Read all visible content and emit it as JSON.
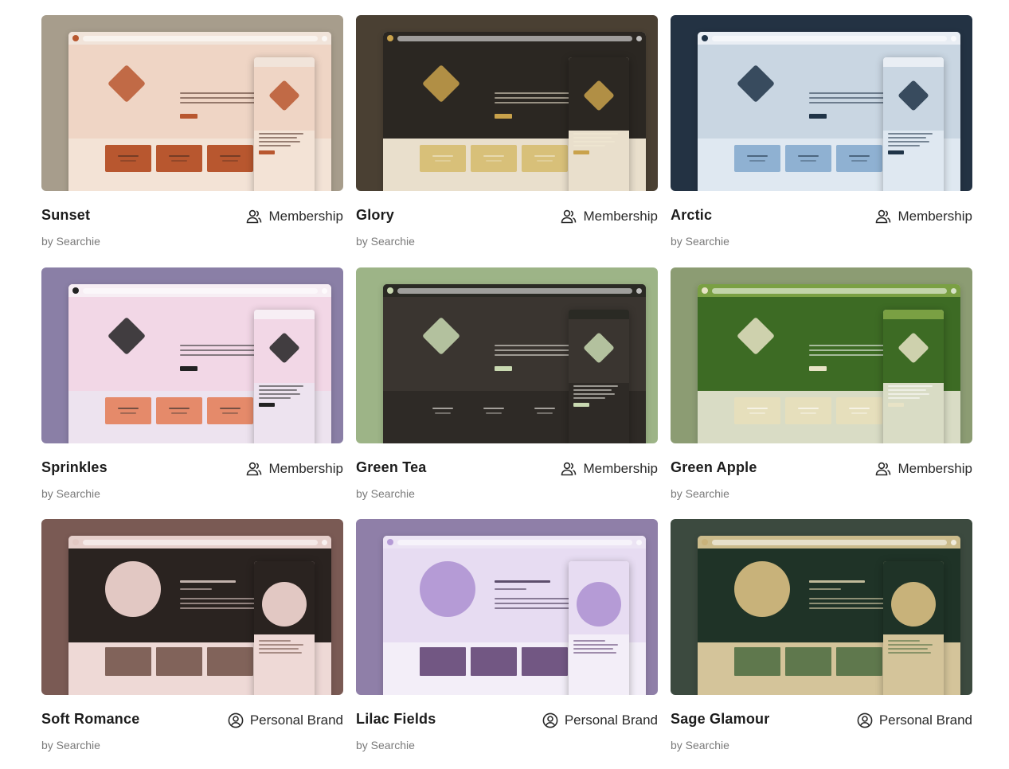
{
  "templates": [
    {
      "name": "Sunset",
      "category": "Membership",
      "author": "by Searchie",
      "icon": "users-icon",
      "colors": {
        "bg": "#a79d8c",
        "page": "#f3e3d6",
        "hero": "#efd5c5",
        "accent": "#b8572f",
        "tile": "#b8572f",
        "bar": "#f1e4da",
        "text": "#4a2c20"
      }
    },
    {
      "name": "Glory",
      "category": "Membership",
      "author": "by Searchie",
      "icon": "users-icon",
      "colors": {
        "bg": "#4a4033",
        "page": "#e9dfcc",
        "hero": "#2b2722",
        "accent": "#c9a24b",
        "tile": "#d8c079",
        "bar": "#2b2722",
        "text": "#f2e9d4"
      }
    },
    {
      "name": "Arctic",
      "category": "Membership",
      "author": "by Searchie",
      "icon": "users-icon",
      "colors": {
        "bg": "#233243",
        "page": "#dfe8f1",
        "hero": "#c9d6e2",
        "accent": "#1f3347",
        "tile": "#8fb1d2",
        "bar": "#e9eef4",
        "text": "#1f3347"
      }
    },
    {
      "name": "Sprinkles",
      "category": "Membership",
      "author": "by Searchie",
      "icon": "users-icon",
      "colors": {
        "bg": "#8a7fa6",
        "page": "#ede3ef",
        "hero": "#f2d7e6",
        "accent": "#222222",
        "tile": "#e58a6a",
        "bar": "#f7eef4",
        "text": "#2a2a2a"
      }
    },
    {
      "name": "Green Tea",
      "category": "Membership",
      "author": "by Searchie",
      "icon": "users-icon",
      "colors": {
        "bg": "#9db487",
        "page": "#2e2a26",
        "hero": "#3a3530",
        "accent": "#c9d9b1",
        "tile": "#2e2a26",
        "bar": "#2a2a24",
        "text": "#f2efe8"
      }
    },
    {
      "name": "Green Apple",
      "category": "Membership",
      "author": "by Searchie",
      "icon": "users-icon",
      "colors": {
        "bg": "#8c9c73",
        "page": "#d9dcc5",
        "hero": "#3d6b24",
        "accent": "#e8e3c6",
        "tile": "#e6dfbc",
        "bar": "#7aa043",
        "text": "#ffffff"
      }
    },
    {
      "name": "Soft Romance",
      "category": "Personal Brand",
      "author": "by Searchie",
      "icon": "user-circle-icon",
      "colors": {
        "bg": "#7a5a54",
        "page": "#eed9d6",
        "hero": "#2a2320",
        "accent": "#e2c8c3",
        "tile": "#6d4d44",
        "bar": "#e6cfcb",
        "text": "#e9d6cf"
      }
    },
    {
      "name": "Lilac Fields",
      "category": "Personal Brand",
      "author": "by Searchie",
      "icon": "user-circle-icon",
      "colors": {
        "bg": "#8f7fa8",
        "page": "#f3eef8",
        "hero": "#e7dcf2",
        "accent": "#b59bd6",
        "tile": "#5a3c6e",
        "bar": "#ece4f4",
        "text": "#3b2a4a"
      }
    },
    {
      "name": "Sage Glamour",
      "category": "Personal Brand",
      "author": "by Searchie",
      "icon": "user-circle-icon",
      "colors": {
        "bg": "#3c4a3f",
        "page": "#d4c49a",
        "hero": "#1f3327",
        "accent": "#c8b27a",
        "tile": "#4a6b3f",
        "bar": "#cbbb8b",
        "text": "#e9dcb6"
      }
    }
  ]
}
